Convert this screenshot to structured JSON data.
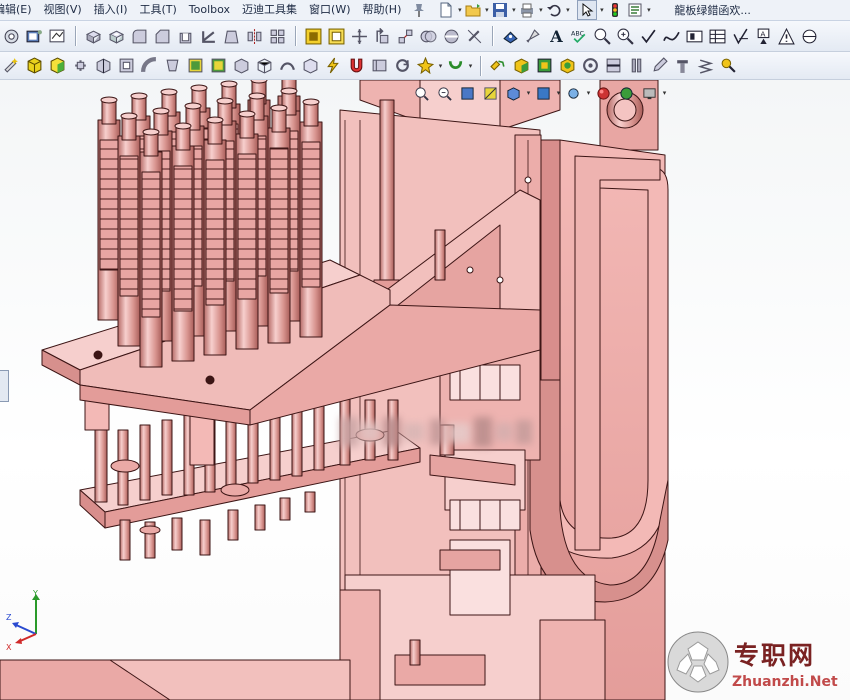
{
  "menubar": {
    "items": [
      "编辑(E)",
      "视图(V)",
      "插入(I)",
      "工具(T)",
      "Toolbox",
      "迈迪工具集",
      "窗口(W)",
      "帮助(H)"
    ],
    "document_title": "龍板绿錯函欢..."
  },
  "watermark": {
    "text_cn": "专职网",
    "text_en": "Zhuanzhi.Net"
  },
  "triad_axes": {
    "y": "Y",
    "z": "Z",
    "x": "X"
  },
  "colors": {
    "model_face": "#ecaaa8",
    "model_light": "#f6cfcd",
    "model_dark": "#b8706c",
    "model_edge": "#3c1515",
    "toolbar_bg": "#e8edf5",
    "viewport_bg": "#f6f8f9",
    "watermark_red": "#7a2222"
  },
  "icons": {
    "menubar": [
      "pin-icon",
      "new-document-icon",
      "open-folder-icon",
      "save-icon",
      "print-icon",
      "undo-icon",
      "select-arrow-icon",
      "rebuild-traffic-light-icon",
      "options-icon"
    ],
    "toolbar1": [
      "hole-wizard-icon",
      "display-pane-icon",
      "sketch-icon",
      "extrude-icon",
      "cut-icon",
      "fillet-icon",
      "chamfer-icon",
      "shell-icon",
      "rib-icon",
      "draft-icon",
      "mirror-icon",
      "pattern-icon",
      "mate-yellow-icon",
      "mate-highlight-icon",
      "move-component-icon",
      "rotate-component-icon",
      "explode-icon",
      "interference-icon",
      "hide-show-icon",
      "dimension-icon",
      "smart-dimension-icon",
      "note-icon",
      "balloon-icon",
      "zoom-fit-icon",
      "zoom-area-icon",
      "check-icon",
      "spline-icon",
      "block-icon",
      "table-icon",
      "abc-spelling-icon",
      "surface-finish-icon",
      "warning-triangle-icon",
      "datum-icon"
    ],
    "toolbar2": [
      "wizard-icon",
      "yellow-cube-icon",
      "green-cube-icon",
      "rotate-part-icon",
      "section-view-icon",
      "wrap-icon",
      "sweep-icon",
      "loft-icon",
      "display-style-icon",
      "shaded-icon",
      "hidden-lines-icon",
      "wireframe-icon",
      "curve-icon",
      "bounding-box-icon",
      "lightning-icon",
      "magnet-icon",
      "bookmark-icon",
      "rotate-view-icon",
      "star-sparkle-icon",
      "arc-icon",
      "group-icon",
      "flat-pattern-icon",
      "sheet-metal-icon",
      "gear-part-icon",
      "surface-icon",
      "weld-icon",
      "library-icon",
      "pencil-icon",
      "fastener-icon",
      "spring-icon",
      "search-part-icon"
    ],
    "hud": [
      "zoom-to-fit-icon",
      "zoom-area-icon",
      "previous-view-icon",
      "section-view-icon",
      "view-orientation-icon",
      "display-style-icon",
      "hide-show-items-icon",
      "appearance-icon",
      "scene-icon",
      "monitor-icon"
    ]
  }
}
